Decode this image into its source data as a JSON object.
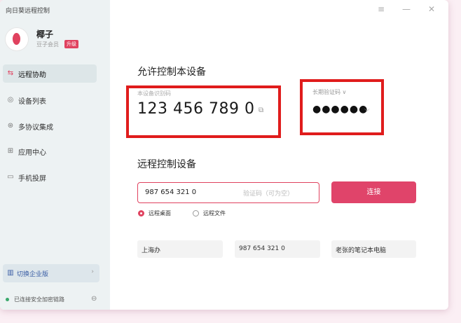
{
  "app": {
    "title": "向日葵远程控制"
  },
  "profile": {
    "name": "椰子",
    "level": "豆子会员",
    "upgrade": "升级"
  },
  "nav": [
    {
      "label": "远程协助",
      "icon": "remote-assist-icon",
      "glyph": "⇆",
      "active": true
    },
    {
      "label": "设备列表",
      "icon": "device-list-icon",
      "glyph": "◎",
      "active": false
    },
    {
      "label": "多协议集成",
      "icon": "protocol-icon",
      "glyph": "⊛",
      "active": false
    },
    {
      "label": "应用中心",
      "icon": "app-grid-icon",
      "glyph": "⊞",
      "active": false
    },
    {
      "label": "手机投屏",
      "icon": "screen-cast-icon",
      "glyph": "▭",
      "active": false
    }
  ],
  "enterprise": {
    "label": "切换企业版",
    "arrow": "›"
  },
  "security": {
    "status": "已连接安全加密链路"
  },
  "window_controls": {
    "menu": "≡",
    "minimize": "—",
    "close": "✕"
  },
  "local": {
    "title": "允许控制本设备",
    "id_label": "本设备识别码",
    "device_id": "123 456 789 0",
    "code_label": "长期验证码 ∨",
    "code_value": "●●●●●●"
  },
  "remote": {
    "title": "远程控制设备",
    "device_id_value": "987 654 321 0",
    "code_placeholder": "验证码（可为空）",
    "connect_label": "连接",
    "options": [
      {
        "label": "远程桌面",
        "checked": true
      },
      {
        "label": "远程文件",
        "checked": false
      }
    ]
  },
  "recent": {
    "location": "上海办",
    "device_id": "987 654 321 0",
    "device_name": "老张的笔记本电脑"
  },
  "colors": {
    "accent": "#e0425f",
    "highlight": "#e01c1c",
    "sidebar": "#edf2f3"
  }
}
